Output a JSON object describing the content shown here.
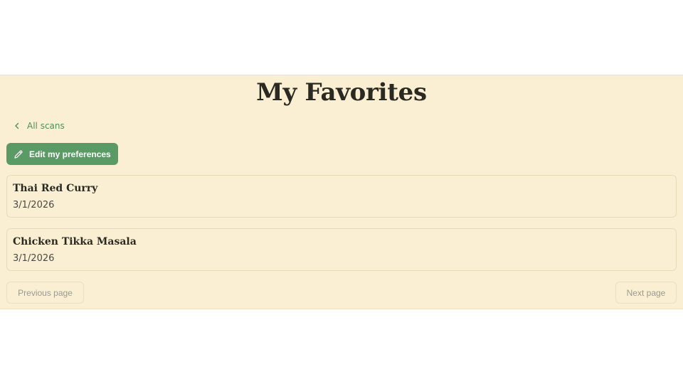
{
  "header": {
    "title": "My Favorites"
  },
  "nav": {
    "back_label": "All scans",
    "back_icon": "chevron-left-icon"
  },
  "actions": {
    "edit_label": "Edit my preferences",
    "edit_icon": "pencil-icon"
  },
  "favorites": [
    {
      "title": "Thai Red Curry",
      "date": "3/1/2026"
    },
    {
      "title": "Chicken Tikka Masala",
      "date": "3/1/2026"
    }
  ],
  "pagination": {
    "previous_label": "Previous page",
    "next_label": "Next page"
  },
  "colors": {
    "panel_background": "#faefd2",
    "accent_green": "#5a9a64",
    "link_green": "#4e8f5a",
    "title_text": "#2b2a22",
    "muted_text": "#9a9a90"
  }
}
